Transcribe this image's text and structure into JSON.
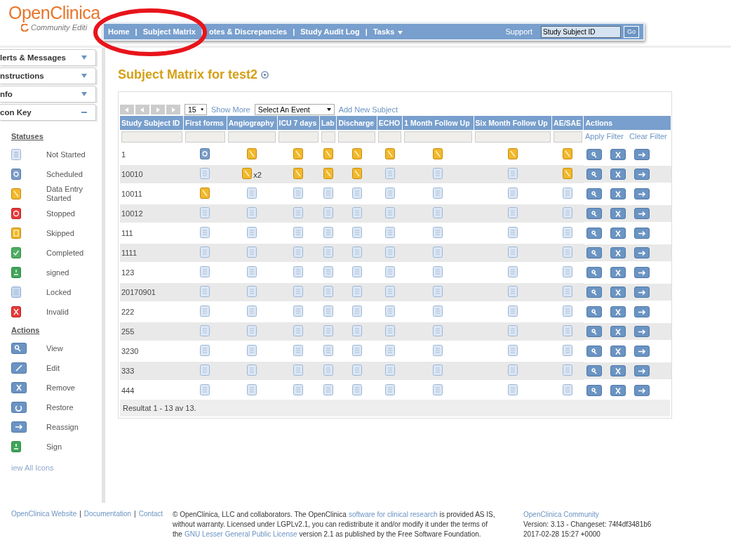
{
  "logo": {
    "name": "OpenClinica",
    "edition": "Community Editi"
  },
  "nav": {
    "separator": "|",
    "items": [
      {
        "label": "Home"
      },
      {
        "label": "Subject Matrix"
      },
      {
        "label": "otes & Discrepancies"
      },
      {
        "label": "Study Audit Log"
      },
      {
        "label": "Tasks",
        "dropdown": true
      }
    ],
    "support": "Support",
    "search": {
      "value": "Study Subject ID"
    },
    "go": "Go"
  },
  "sidebar": {
    "panels": [
      {
        "title": "lerts & Messages",
        "expanded": false
      },
      {
        "title": "nstructions",
        "expanded": false
      },
      {
        "title": "nfo",
        "expanded": false
      },
      {
        "title": "con Key",
        "expanded": true
      }
    ],
    "statuses_heading": "Statuses",
    "statuses": [
      {
        "kind": "not_started",
        "label": "Not Started"
      },
      {
        "kind": "scheduled",
        "label": "Scheduled"
      },
      {
        "kind": "started",
        "label": "Data Entry Started"
      },
      {
        "kind": "stopped",
        "label": "Stopped"
      },
      {
        "kind": "skipped",
        "label": "Skipped"
      },
      {
        "kind": "completed",
        "label": "Completed"
      },
      {
        "kind": "signed",
        "label": "signed"
      },
      {
        "kind": "locked",
        "label": "Locked"
      },
      {
        "kind": "invalid",
        "label": "Invalid"
      }
    ],
    "actions_heading": "Actions",
    "actions": [
      {
        "kind": "view",
        "label": "View"
      },
      {
        "kind": "edit",
        "label": "Edit"
      },
      {
        "kind": "remove",
        "label": "Remove"
      },
      {
        "kind": "restore",
        "label": "Restore"
      },
      {
        "kind": "reassign",
        "label": "Reassign"
      },
      {
        "kind": "sign",
        "label": "Sign"
      }
    ],
    "view_all": "iew All Icons"
  },
  "title": "Subject Matrix for test2",
  "toolbar": {
    "page_size": "15",
    "show_more": "Show More",
    "event_select": "Select An Event",
    "add_subject": "Add New Subject"
  },
  "table": {
    "columns": [
      "Study Subject ID",
      "First forms",
      "Angiography",
      "ICU 7 days",
      "Lab",
      "Discharge",
      "ECHO",
      "1 Month Follow Up",
      "Six Month Follow Up",
      "AE/SAE",
      "Actions"
    ],
    "apply_filter": "Apply Filter",
    "clear_filter": "Clear Filter",
    "row_actions": [
      {
        "kind": "view"
      },
      {
        "kind": "remove"
      },
      {
        "kind": "reassign"
      }
    ],
    "rows": [
      {
        "cells": [
          {
            "text": "1"
          },
          {
            "kind": "scheduled"
          },
          {
            "kind": "started"
          },
          {
            "kind": "started"
          },
          {
            "kind": "started"
          },
          {
            "kind": "started"
          },
          {
            "kind": "started"
          },
          {
            "kind": "started"
          },
          {
            "kind": "started"
          },
          {
            "kind": "started"
          }
        ]
      },
      {
        "cells": [
          {
            "text": "10010"
          },
          {
            "kind": "not_started"
          },
          {
            "kind": "started",
            "count": "x2"
          },
          {
            "kind": "started"
          },
          {
            "kind": "started"
          },
          {
            "kind": "started"
          },
          {
            "kind": "not_started"
          },
          {
            "kind": "not_started"
          },
          {
            "kind": "not_started"
          },
          {
            "kind": "started"
          }
        ]
      },
      {
        "cells": [
          {
            "text": "10011"
          },
          {
            "kind": "started"
          },
          {
            "kind": "not_started"
          },
          {
            "kind": "not_started"
          },
          {
            "kind": "not_started"
          },
          {
            "kind": "not_started"
          },
          {
            "kind": "not_started"
          },
          {
            "kind": "not_started"
          },
          {
            "kind": "not_started"
          },
          {
            "kind": "not_started"
          }
        ]
      },
      {
        "cells": [
          {
            "text": "10012"
          },
          {
            "kind": "not_started"
          },
          {
            "kind": "not_started"
          },
          {
            "kind": "not_started"
          },
          {
            "kind": "not_started"
          },
          {
            "kind": "not_started"
          },
          {
            "kind": "not_started"
          },
          {
            "kind": "not_started"
          },
          {
            "kind": "not_started"
          },
          {
            "kind": "not_started"
          }
        ]
      },
      {
        "cells": [
          {
            "text": "111"
          },
          {
            "kind": "not_started"
          },
          {
            "kind": "not_started"
          },
          {
            "kind": "not_started"
          },
          {
            "kind": "not_started"
          },
          {
            "kind": "not_started"
          },
          {
            "kind": "not_started"
          },
          {
            "kind": "not_started"
          },
          {
            "kind": "not_started"
          },
          {
            "kind": "not_started"
          }
        ]
      },
      {
        "cells": [
          {
            "text": "1111"
          },
          {
            "kind": "not_started"
          },
          {
            "kind": "not_started"
          },
          {
            "kind": "not_started"
          },
          {
            "kind": "not_started"
          },
          {
            "kind": "not_started"
          },
          {
            "kind": "not_started"
          },
          {
            "kind": "not_started"
          },
          {
            "kind": "not_started"
          },
          {
            "kind": "not_started"
          }
        ]
      },
      {
        "cells": [
          {
            "text": "123"
          },
          {
            "kind": "not_started"
          },
          {
            "kind": "not_started"
          },
          {
            "kind": "not_started"
          },
          {
            "kind": "not_started"
          },
          {
            "kind": "not_started"
          },
          {
            "kind": "not_started"
          },
          {
            "kind": "not_started"
          },
          {
            "kind": "not_started"
          },
          {
            "kind": "not_started"
          }
        ]
      },
      {
        "cells": [
          {
            "text": "20170901"
          },
          {
            "kind": "not_started"
          },
          {
            "kind": "not_started"
          },
          {
            "kind": "not_started"
          },
          {
            "kind": "not_started"
          },
          {
            "kind": "not_started"
          },
          {
            "kind": "not_started"
          },
          {
            "kind": "not_started"
          },
          {
            "kind": "not_started"
          },
          {
            "kind": "not_started"
          }
        ]
      },
      {
        "cells": [
          {
            "text": "222"
          },
          {
            "kind": "not_started"
          },
          {
            "kind": "not_started"
          },
          {
            "kind": "not_started"
          },
          {
            "kind": "not_started"
          },
          {
            "kind": "not_started"
          },
          {
            "kind": "not_started"
          },
          {
            "kind": "not_started"
          },
          {
            "kind": "not_started"
          },
          {
            "kind": "not_started"
          }
        ]
      },
      {
        "cells": [
          {
            "text": "255"
          },
          {
            "kind": "not_started"
          },
          {
            "kind": "not_started"
          },
          {
            "kind": "not_started"
          },
          {
            "kind": "not_started"
          },
          {
            "kind": "not_started"
          },
          {
            "kind": "not_started"
          },
          {
            "kind": "not_started"
          },
          {
            "kind": "not_started"
          },
          {
            "kind": "not_started"
          }
        ]
      },
      {
        "cells": [
          {
            "text": "3230"
          },
          {
            "kind": "not_started"
          },
          {
            "kind": "not_started"
          },
          {
            "kind": "not_started"
          },
          {
            "kind": "not_started"
          },
          {
            "kind": "not_started"
          },
          {
            "kind": "not_started"
          },
          {
            "kind": "not_started"
          },
          {
            "kind": "not_started"
          },
          {
            "kind": "not_started"
          }
        ]
      },
      {
        "cells": [
          {
            "text": "333"
          },
          {
            "kind": "not_started"
          },
          {
            "kind": "not_started"
          },
          {
            "kind": "not_started"
          },
          {
            "kind": "not_started"
          },
          {
            "kind": "not_started"
          },
          {
            "kind": "not_started"
          },
          {
            "kind": "not_started"
          },
          {
            "kind": "not_started"
          },
          {
            "kind": "not_started"
          }
        ]
      },
      {
        "cells": [
          {
            "text": "444"
          },
          {
            "kind": "not_started"
          },
          {
            "kind": "not_started"
          },
          {
            "kind": "not_started"
          },
          {
            "kind": "not_started"
          },
          {
            "kind": "not_started"
          },
          {
            "kind": "not_started"
          },
          {
            "kind": "not_started"
          },
          {
            "kind": "not_started"
          },
          {
            "kind": "not_started"
          }
        ]
      }
    ],
    "summary": "Resultat 1 - 13 av 13."
  },
  "footer": {
    "separator": "|",
    "links": [
      "OpenClinica Website",
      "Documentation",
      "Contact"
    ],
    "license": [
      [
        {
          "text": "© OpenClinica, LLC and collaborators. The OpenClinica"
        },
        {
          "link": "software for clinical research"
        },
        {
          "text": "is provided AS IS,"
        }
      ],
      [
        {
          "text": "without warranty. Licensed under LGPLv2.1, you can redistribute it and/or modify it under the terms of"
        }
      ],
      [
        {
          "text": "the"
        },
        {
          "link": "GNU Lesser General Public License"
        },
        {
          "text": "version 2.1 as published by the Free Software Foundation."
        }
      ]
    ],
    "community": "OpenClinica Community",
    "version": "Version: 3.13 - Changeset: 74f4df3481b6",
    "date": "2017-02-28 15:27 +0000"
  }
}
